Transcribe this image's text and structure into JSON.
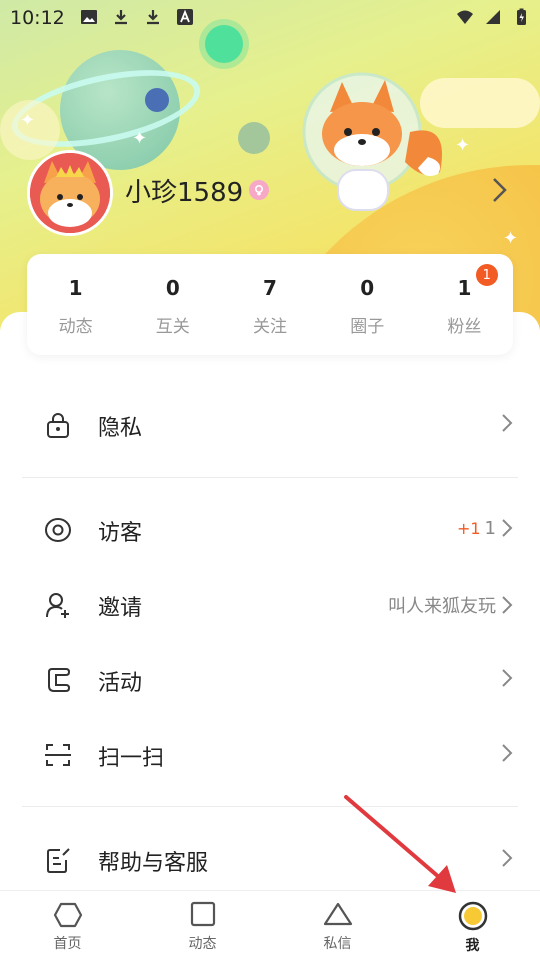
{
  "status_bar": {
    "time": "10:12",
    "icons": [
      "image-icon",
      "download-icon",
      "download-icon",
      "font-icon"
    ],
    "right_icons": [
      "wifi-icon",
      "signal-icon",
      "battery-charging-icon"
    ]
  },
  "profile": {
    "username": "小珍1589",
    "gender_icon": "female-icon"
  },
  "stats": [
    {
      "value": "1",
      "label": "动态"
    },
    {
      "value": "0",
      "label": "互关"
    },
    {
      "value": "7",
      "label": "关注"
    },
    {
      "value": "0",
      "label": "圈子"
    },
    {
      "value": "1",
      "label": "粉丝",
      "badge": "1"
    }
  ],
  "menu": [
    {
      "label": "隐私",
      "icon": "lock-icon",
      "right_text": "",
      "plus": ""
    },
    {
      "label": "访客",
      "icon": "eye-icon",
      "right_text": "1",
      "plus": "+1"
    },
    {
      "label": "邀请",
      "icon": "add-user-icon",
      "right_text": "叫人来狐友玩",
      "plus": ""
    },
    {
      "label": "活动",
      "icon": "scroll-icon",
      "right_text": "",
      "plus": ""
    },
    {
      "label": "扫一扫",
      "icon": "scan-icon",
      "right_text": "",
      "plus": ""
    },
    {
      "label": "帮助与客服",
      "icon": "help-note-icon",
      "right_text": "",
      "plus": ""
    }
  ],
  "tabs": [
    {
      "label": "首页",
      "icon": "hexagon-icon"
    },
    {
      "label": "动态",
      "icon": "square-icon"
    },
    {
      "label": "私信",
      "icon": "triangle-icon"
    },
    {
      "label": "我",
      "icon": "me-circle-icon",
      "active": true
    }
  ],
  "colors": {
    "accent": "#f25b24",
    "active_tab": "#f7c935",
    "annotation_arrow": "#e0393e"
  }
}
